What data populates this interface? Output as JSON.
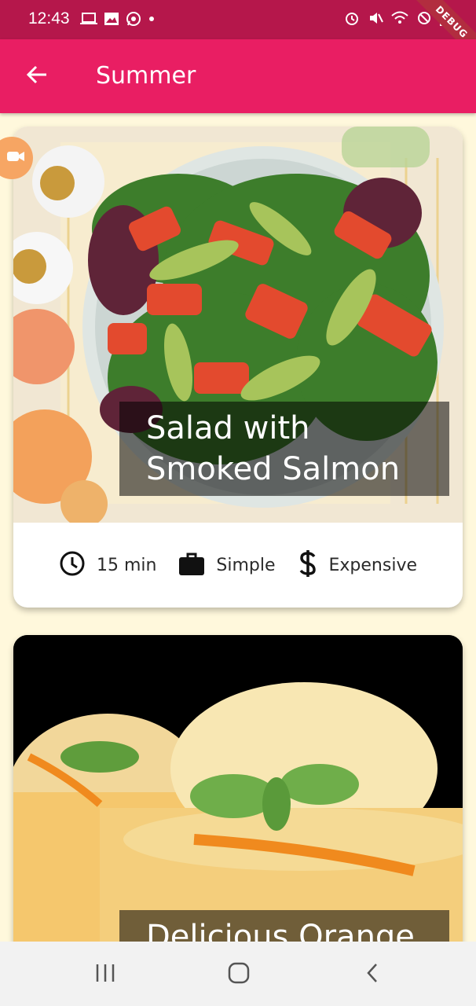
{
  "status_bar": {
    "time": "12:43",
    "debug_label": "DEBUG",
    "icons_left": [
      "laptop-icon",
      "image-icon",
      "whatsapp-icon",
      "dot-icon"
    ],
    "icons_right": [
      "alarm-icon",
      "mute-icon",
      "wifi-icon",
      "no-signal-icon",
      "battery-icon"
    ]
  },
  "app_bar": {
    "title": "Summer",
    "back_icon": "arrow-back-icon",
    "color": "#e91e63"
  },
  "recipes": [
    {
      "title": "Salad with Smoked Salmon",
      "duration": "15 min",
      "complexity": "Simple",
      "affordability": "Expensive"
    },
    {
      "title": "Delicious Orange"
    }
  ],
  "colors": {
    "status_bar": "#b5174b",
    "app_bar": "#e91e63",
    "background": "#fff8dc"
  }
}
